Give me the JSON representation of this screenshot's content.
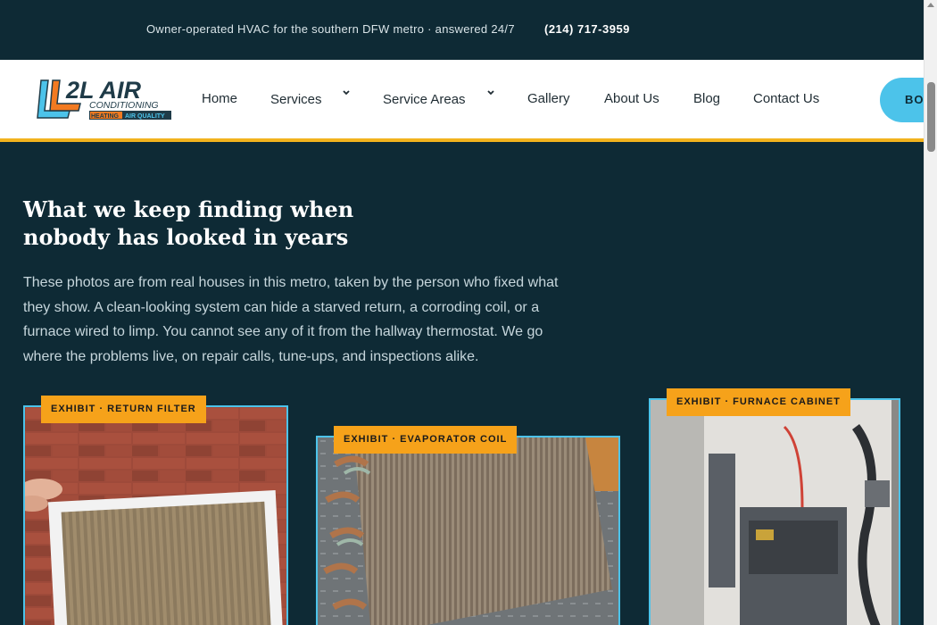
{
  "topbar": {
    "tagline": "Owner-operated HVAC for the southern DFW metro · answered 24/7",
    "phone": "(214) 717-3959"
  },
  "logo": {
    "line1": "2L AIR",
    "line2": "CONDITIONING",
    "line3a": "HEATING",
    "line3b": "AIR QUALITY"
  },
  "nav": {
    "items": [
      {
        "label": "Home",
        "has_dropdown": false
      },
      {
        "label": "Services",
        "has_dropdown": true
      },
      {
        "label": "Service Areas",
        "has_dropdown": true
      },
      {
        "label": "Gallery",
        "has_dropdown": false
      },
      {
        "label": "About Us",
        "has_dropdown": false
      },
      {
        "label": "Blog",
        "has_dropdown": false
      },
      {
        "label": "Contact Us",
        "has_dropdown": false
      }
    ],
    "chevron": "⌄",
    "book_label": "BO"
  },
  "main": {
    "heading": "What we keep finding when nobody has looked in years",
    "intro": "These photos are from real houses in this metro, taken by the person who fixed what they show. A clean-looking system can hide a starved return, a corroding coil, or a furnace wired to limp. You cannot see any of it from the hallway thermostat. We go where the problems live, on repair calls, tune-ups, and inspections alike."
  },
  "exhibits": [
    {
      "tag": "EXHIBIT · RETURN FILTER",
      "photo": "dirty-return-filter"
    },
    {
      "tag": "EXHIBIT · EVAPORATOR COIL",
      "photo": "corroded-evaporator-coil"
    },
    {
      "tag": "EXHIBIT · FURNACE CABINET",
      "photo": "furnace-cabinet"
    }
  ],
  "colors": {
    "background": "#0e2a35",
    "accent": "#4cc3ea",
    "tag": "#f6a21a",
    "header_border": "#f2b31e"
  }
}
